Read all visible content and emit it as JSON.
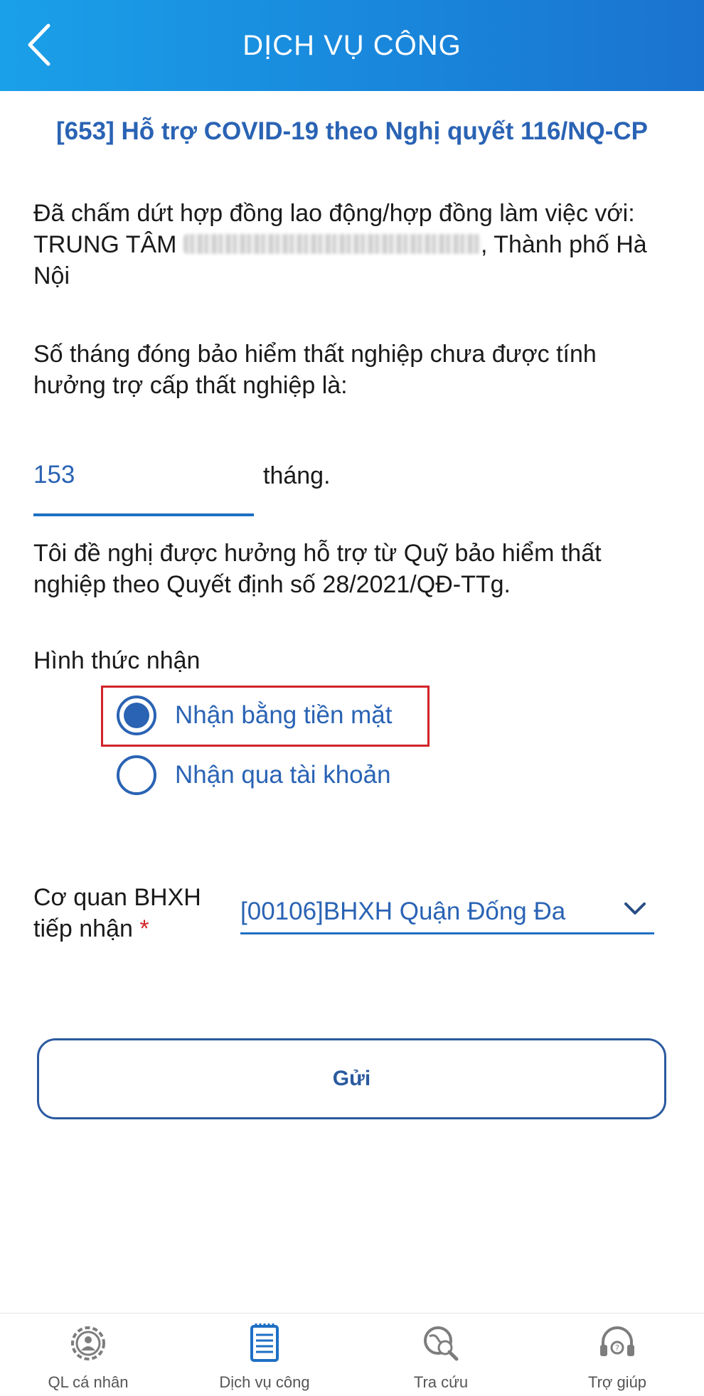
{
  "header": {
    "title": "DỊCH VỤ CÔNG",
    "back_icon": "chevron-left-icon"
  },
  "form": {
    "service_title": "[653] Hỗ trợ COVID-19 theo Nghị quyết 116/NQ-CP",
    "contract_text_before": "Đã chấm dứt hợp đồng  lao động/hợp đồng làm việc với: TRUNG TÂM ",
    "contract_text_after": ", Thành phố Hà Nội",
    "months_question": "Số tháng đóng bảo hiểm thất nghiệp chưa được tính hưởng trợ cấp thất nghiệp là:",
    "months_value": "153",
    "months_unit": "tháng.",
    "request_text": "Tôi đề nghị được hưởng hỗ trợ từ Quỹ bảo hiểm thất nghiệp theo Quyết định số 28/2021/QĐ-TTg.",
    "receive_method_label": "Hình thức nhận",
    "receive_options": [
      {
        "label": "Nhận bằng tiền mặt",
        "selected": true
      },
      {
        "label": "Nhận qua tài khoản",
        "selected": false
      }
    ],
    "agency_label_line1": "Cơ quan BHXH",
    "agency_label_line2": "tiếp nhận",
    "required_mark": "*",
    "agency_selected": "[00106]BHXH Quận Đống Đa",
    "submit_label": "Gửi"
  },
  "bottom_nav": [
    {
      "label": "QL cá nhân",
      "icon": "personal-gear-icon"
    },
    {
      "label": "Dịch vụ công",
      "icon": "document-icon"
    },
    {
      "label": "Tra cứu",
      "icon": "globe-search-icon"
    },
    {
      "label": "Trợ giúp",
      "icon": "headset-icon"
    }
  ],
  "colors": {
    "header": "#1a8fe0",
    "accent": "#2a63b4",
    "highlight": "#d2232a"
  }
}
